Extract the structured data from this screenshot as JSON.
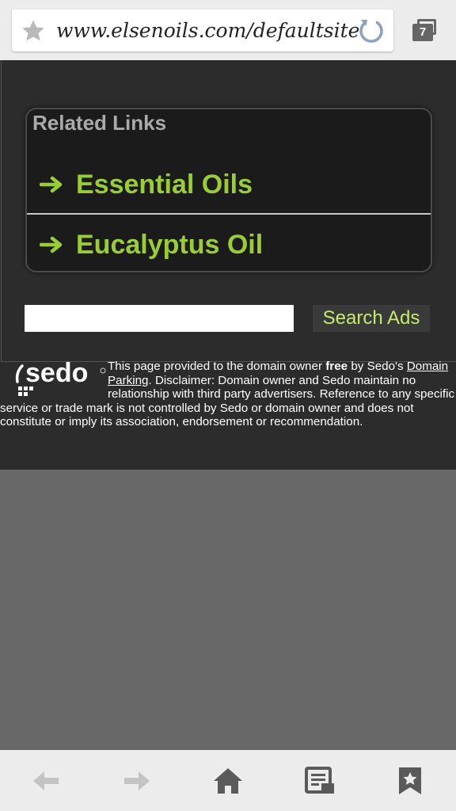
{
  "browser": {
    "url": "www.elsenoils.com/defaultsite",
    "tab_count": "7",
    "icons": {
      "star": "star-icon",
      "reload": "reload-icon",
      "tabs": "tabs-icon"
    }
  },
  "related_links": {
    "title": "Related Links",
    "items": [
      {
        "label": "Essential Oils",
        "icon": "arrow-right-icon"
      },
      {
        "label": "Eucalyptus Oil",
        "icon": "arrow-right-icon"
      }
    ]
  },
  "search": {
    "value": "",
    "button_label": "Search Ads"
  },
  "footer": {
    "logo_text": "sedo",
    "text_1": "This page provided to the domain owner ",
    "text_free": "free",
    "text_2": " by Sedo's ",
    "link_parking": "Domain Parking",
    "text_3": ". Disclaimer: Domain owner and Sedo maintain no relationship with third party advertisers. Reference to any specific service or trade mark is not controlled by Sedo or domain owner and does not constitute or imply its association, endorsement or recommendation."
  },
  "bottom_nav": [
    "back-icon",
    "forward-icon",
    "home-icon",
    "reader-icon",
    "bookmark-icon"
  ],
  "colors": {
    "link_green": "#9acd32",
    "search_label": "#c6ea6a",
    "panel_bg": "#2c2c2c",
    "box_bg": "#1b1b1b",
    "below_page": "#686868"
  }
}
